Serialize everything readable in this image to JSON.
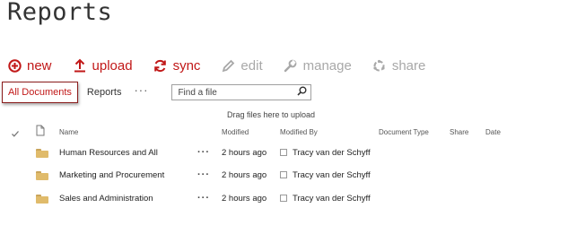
{
  "page": {
    "title": "Reports"
  },
  "toolbar": {
    "new_label": "new",
    "upload_label": "upload",
    "sync_label": "sync",
    "edit_label": "edit",
    "manage_label": "manage",
    "share_label": "share"
  },
  "views": {
    "active": "All Documents",
    "other": "Reports",
    "more": "···"
  },
  "search": {
    "placeholder": "Find a file",
    "value": ""
  },
  "dropzone": "Drag files here to upload",
  "columns": {
    "name": "Name",
    "modified": "Modified",
    "modified_by": "Modified By",
    "document_type": "Document Type",
    "share": "Share",
    "date": "Date"
  },
  "rows": [
    {
      "name": "Human Resources and All",
      "more": "···",
      "modified": "2 hours ago",
      "modified_by": "Tracy van der Schyff"
    },
    {
      "name": "Marketing and Procurement",
      "more": "···",
      "modified": "2 hours ago",
      "modified_by": "Tracy van der Schyff"
    },
    {
      "name": "Sales and Administration",
      "more": "···",
      "modified": "2 hours ago",
      "modified_by": "Tracy van der Schyff"
    }
  ],
  "colors": {
    "accent": "#c11818",
    "disabled": "#a8a8a8",
    "folder": "#e0bb6b"
  }
}
